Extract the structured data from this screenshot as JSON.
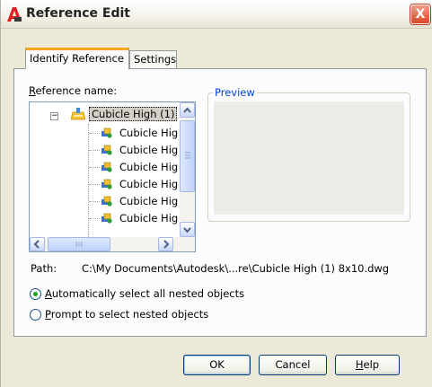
{
  "window": {
    "title": "Reference Edit",
    "close_glyph": "X",
    "app_icon": "autocad-icon"
  },
  "tabs": [
    {
      "label": "Identify Reference",
      "active": true
    },
    {
      "label": "Settings",
      "active": false
    }
  ],
  "reference": {
    "label_first": "R",
    "label_rest": "eference name:",
    "tree": {
      "root": {
        "label": "Cubicle High (1)",
        "icon": "folder-block-icon",
        "expanded": true
      },
      "children": [
        {
          "label": "Cubicle Hig",
          "icon": "block-ref-icon"
        },
        {
          "label": "Cubicle Hig",
          "icon": "block-ref-icon"
        },
        {
          "label": "Cubicle Hig",
          "icon": "block-ref-icon"
        },
        {
          "label": "Cubicle Hig",
          "icon": "block-ref-icon"
        },
        {
          "label": "Cubicle Hig",
          "icon": "block-ref-icon"
        },
        {
          "label": "Cubicle Hig",
          "icon": "block-ref-icon"
        }
      ]
    }
  },
  "preview": {
    "title": "Preview"
  },
  "path": {
    "label": "Path:",
    "value": "C:\\My Documents\\Autodesk\\...re\\Cubicle High (1) 8x10.dwg"
  },
  "options": {
    "auto": {
      "first": "A",
      "rest": "utomatically select all nested objects",
      "checked": true
    },
    "prompt": {
      "first": "P",
      "rest": "rompt to select nested objects",
      "checked": false
    }
  },
  "buttons": {
    "ok": "OK",
    "cancel": "Cancel",
    "help_first": "H",
    "help_rest": "elp"
  },
  "colors": {
    "dialog_bg": "#ece9d8",
    "tab_accent": "#f5a623",
    "group_title": "#0046d5",
    "close_red": "#d9492a"
  }
}
